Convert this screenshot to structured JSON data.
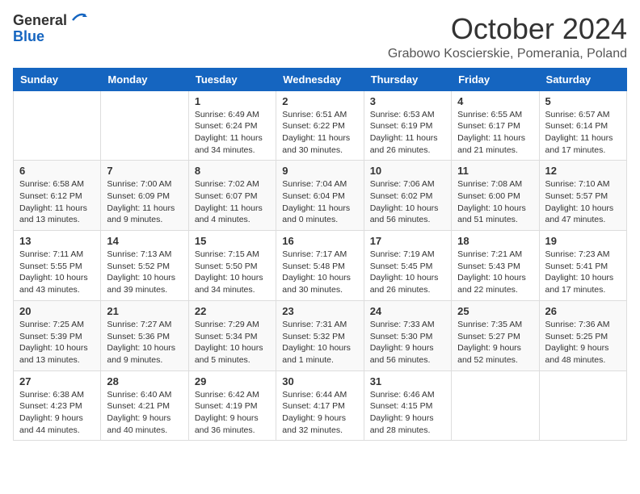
{
  "logo": {
    "text_general": "General",
    "text_blue": "Blue"
  },
  "header": {
    "month": "October 2024",
    "location": "Grabowo Koscierskie, Pomerania, Poland"
  },
  "weekdays": [
    "Sunday",
    "Monday",
    "Tuesday",
    "Wednesday",
    "Thursday",
    "Friday",
    "Saturday"
  ],
  "weeks": [
    [
      {
        "day": "",
        "info": ""
      },
      {
        "day": "",
        "info": ""
      },
      {
        "day": "1",
        "info": "Sunrise: 6:49 AM\nSunset: 6:24 PM\nDaylight: 11 hours\nand 34 minutes."
      },
      {
        "day": "2",
        "info": "Sunrise: 6:51 AM\nSunset: 6:22 PM\nDaylight: 11 hours\nand 30 minutes."
      },
      {
        "day": "3",
        "info": "Sunrise: 6:53 AM\nSunset: 6:19 PM\nDaylight: 11 hours\nand 26 minutes."
      },
      {
        "day": "4",
        "info": "Sunrise: 6:55 AM\nSunset: 6:17 PM\nDaylight: 11 hours\nand 21 minutes."
      },
      {
        "day": "5",
        "info": "Sunrise: 6:57 AM\nSunset: 6:14 PM\nDaylight: 11 hours\nand 17 minutes."
      }
    ],
    [
      {
        "day": "6",
        "info": "Sunrise: 6:58 AM\nSunset: 6:12 PM\nDaylight: 11 hours\nand 13 minutes."
      },
      {
        "day": "7",
        "info": "Sunrise: 7:00 AM\nSunset: 6:09 PM\nDaylight: 11 hours\nand 9 minutes."
      },
      {
        "day": "8",
        "info": "Sunrise: 7:02 AM\nSunset: 6:07 PM\nDaylight: 11 hours\nand 4 minutes."
      },
      {
        "day": "9",
        "info": "Sunrise: 7:04 AM\nSunset: 6:04 PM\nDaylight: 11 hours\nand 0 minutes."
      },
      {
        "day": "10",
        "info": "Sunrise: 7:06 AM\nSunset: 6:02 PM\nDaylight: 10 hours\nand 56 minutes."
      },
      {
        "day": "11",
        "info": "Sunrise: 7:08 AM\nSunset: 6:00 PM\nDaylight: 10 hours\nand 51 minutes."
      },
      {
        "day": "12",
        "info": "Sunrise: 7:10 AM\nSunset: 5:57 PM\nDaylight: 10 hours\nand 47 minutes."
      }
    ],
    [
      {
        "day": "13",
        "info": "Sunrise: 7:11 AM\nSunset: 5:55 PM\nDaylight: 10 hours\nand 43 minutes."
      },
      {
        "day": "14",
        "info": "Sunrise: 7:13 AM\nSunset: 5:52 PM\nDaylight: 10 hours\nand 39 minutes."
      },
      {
        "day": "15",
        "info": "Sunrise: 7:15 AM\nSunset: 5:50 PM\nDaylight: 10 hours\nand 34 minutes."
      },
      {
        "day": "16",
        "info": "Sunrise: 7:17 AM\nSunset: 5:48 PM\nDaylight: 10 hours\nand 30 minutes."
      },
      {
        "day": "17",
        "info": "Sunrise: 7:19 AM\nSunset: 5:45 PM\nDaylight: 10 hours\nand 26 minutes."
      },
      {
        "day": "18",
        "info": "Sunrise: 7:21 AM\nSunset: 5:43 PM\nDaylight: 10 hours\nand 22 minutes."
      },
      {
        "day": "19",
        "info": "Sunrise: 7:23 AM\nSunset: 5:41 PM\nDaylight: 10 hours\nand 17 minutes."
      }
    ],
    [
      {
        "day": "20",
        "info": "Sunrise: 7:25 AM\nSunset: 5:39 PM\nDaylight: 10 hours\nand 13 minutes."
      },
      {
        "day": "21",
        "info": "Sunrise: 7:27 AM\nSunset: 5:36 PM\nDaylight: 10 hours\nand 9 minutes."
      },
      {
        "day": "22",
        "info": "Sunrise: 7:29 AM\nSunset: 5:34 PM\nDaylight: 10 hours\nand 5 minutes."
      },
      {
        "day": "23",
        "info": "Sunrise: 7:31 AM\nSunset: 5:32 PM\nDaylight: 10 hours\nand 1 minute."
      },
      {
        "day": "24",
        "info": "Sunrise: 7:33 AM\nSunset: 5:30 PM\nDaylight: 9 hours\nand 56 minutes."
      },
      {
        "day": "25",
        "info": "Sunrise: 7:35 AM\nSunset: 5:27 PM\nDaylight: 9 hours\nand 52 minutes."
      },
      {
        "day": "26",
        "info": "Sunrise: 7:36 AM\nSunset: 5:25 PM\nDaylight: 9 hours\nand 48 minutes."
      }
    ],
    [
      {
        "day": "27",
        "info": "Sunrise: 6:38 AM\nSunset: 4:23 PM\nDaylight: 9 hours\nand 44 minutes."
      },
      {
        "day": "28",
        "info": "Sunrise: 6:40 AM\nSunset: 4:21 PM\nDaylight: 9 hours\nand 40 minutes."
      },
      {
        "day": "29",
        "info": "Sunrise: 6:42 AM\nSunset: 4:19 PM\nDaylight: 9 hours\nand 36 minutes."
      },
      {
        "day": "30",
        "info": "Sunrise: 6:44 AM\nSunset: 4:17 PM\nDaylight: 9 hours\nand 32 minutes."
      },
      {
        "day": "31",
        "info": "Sunrise: 6:46 AM\nSunset: 4:15 PM\nDaylight: 9 hours\nand 28 minutes."
      },
      {
        "day": "",
        "info": ""
      },
      {
        "day": "",
        "info": ""
      }
    ]
  ]
}
